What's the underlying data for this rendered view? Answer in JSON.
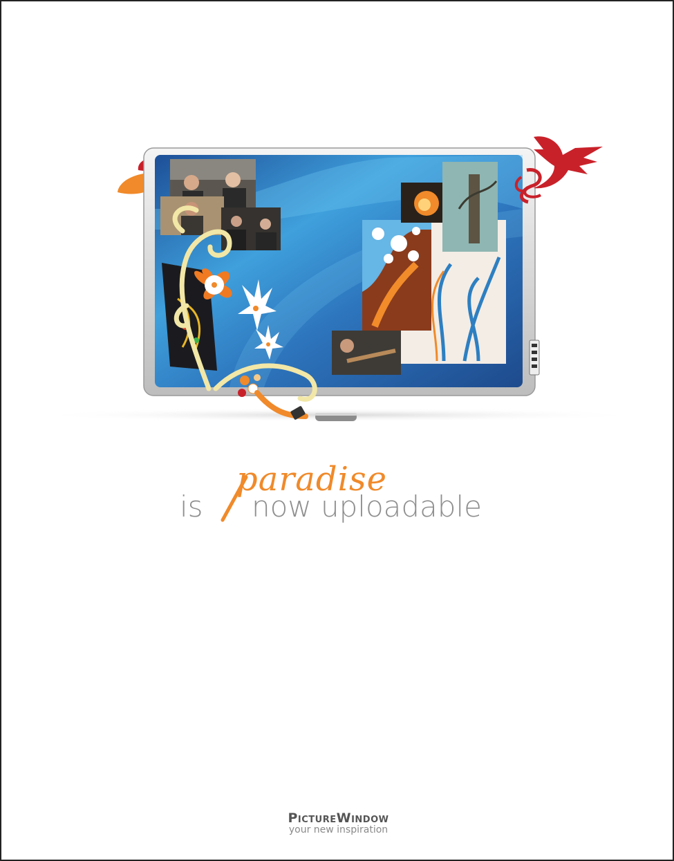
{
  "headline": {
    "script_word": "paradise",
    "lead": "is",
    "rest": "now uploadable"
  },
  "brand": {
    "name": "PictureWindow",
    "tagline": "your new inspiration"
  },
  "colors": {
    "accent_orange": "#f08a2a",
    "headline_gray": "#8f8f8f",
    "bird_red": "#c9212a",
    "screen_blue": "#2f6fb4"
  },
  "icons": [
    "bird-icon",
    "flower-icon",
    "leaf-icon",
    "stylus-icon",
    "swirl-ornament"
  ]
}
